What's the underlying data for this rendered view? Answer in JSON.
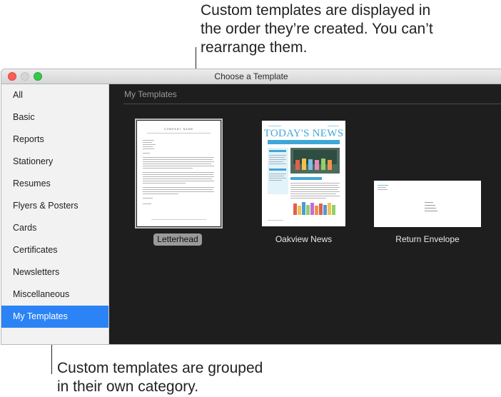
{
  "callouts": {
    "top": [
      "Custom templates are displayed in",
      "the order they’re created. You can’t",
      "rearrange them."
    ],
    "bottom": [
      "Custom templates are grouped",
      "in their own category."
    ]
  },
  "window": {
    "title": "Choose a Template",
    "traffic_lights": [
      "close",
      "minimize",
      "zoom"
    ]
  },
  "sidebar": {
    "items": [
      {
        "label": "All"
      },
      {
        "label": "Basic"
      },
      {
        "label": "Reports"
      },
      {
        "label": "Stationery"
      },
      {
        "label": "Resumes"
      },
      {
        "label": "Flyers & Posters"
      },
      {
        "label": "Cards"
      },
      {
        "label": "Certificates"
      },
      {
        "label": "Newsletters"
      },
      {
        "label": "Miscellaneous"
      },
      {
        "label": "My Templates"
      }
    ],
    "selected_index": 10
  },
  "main": {
    "section_title": "My Templates",
    "templates": [
      {
        "label": "Letterhead",
        "selected": true,
        "preview_heading": "COMPANY NAME"
      },
      {
        "label": "Oakview News",
        "selected": false,
        "preview_heading": "TODAY'S NEWS"
      },
      {
        "label": "Return Envelope",
        "selected": false
      }
    ]
  },
  "colors": {
    "selection_blue": "#2c83f6",
    "main_background": "#1e1e1e",
    "sidebar_background": "#f2f2f2",
    "news_accent": "#3fa7d6"
  }
}
